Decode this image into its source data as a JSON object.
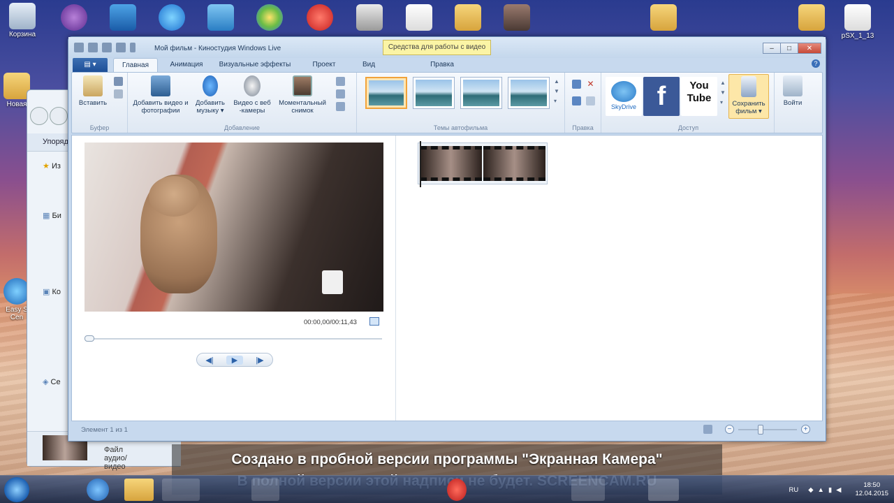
{
  "desktop": {
    "icons_left": [
      "Корзина",
      "Новая",
      "Easy S Cen"
    ],
    "icons_right": [
      "pSX_1_13"
    ]
  },
  "explorer": {
    "organize": "Упоряд",
    "tree": [
      "Из",
      "Би",
      "Ко",
      "Се"
    ],
    "status": "Файл аудио/видео"
  },
  "window": {
    "title": "Мой фильм - Киностудия Windows Live",
    "context_tab": "Средства для работы с видео",
    "context_sub": "Правка",
    "controls": {
      "min": "–",
      "max": "□",
      "close": "✕"
    }
  },
  "tabs": [
    {
      "label": ""
    },
    {
      "label": "Главная"
    },
    {
      "label": "Анимация"
    },
    {
      "label": "Визуальные эффекты"
    },
    {
      "label": "Проект"
    },
    {
      "label": "Вид"
    },
    {
      "label": "Правка"
    }
  ],
  "ribbon": {
    "buffer": {
      "paste": "Вставить",
      "label": "Буфер"
    },
    "add": {
      "add_video": "Добавить видео и фотографии",
      "add_music": "Добавить музыку ▾",
      "webcam": "Видео с веб -камеры",
      "snapshot": "Моментальный снимок",
      "label": "Добавление"
    },
    "themes": {
      "label": "Темы автофильма"
    },
    "edit": {
      "label": "Правка"
    },
    "share": {
      "skydrive": "SkyDrive",
      "facebook": "f",
      "youtube": "You Tube",
      "save_movie": "Сохранить фильм ▾",
      "label": "Доступ"
    },
    "signin": "Войти"
  },
  "preview": {
    "timecode": "00:00,00/00:11,43",
    "transport": {
      "prev": "◀|",
      "play": "▶",
      "next": "|▶"
    }
  },
  "status": {
    "text": "Элемент 1 из 1",
    "zoom_out": "−",
    "zoom_in": "+"
  },
  "watermark": {
    "line1": "Создано в пробной версии программы \"Экранная Камера\"",
    "line2": "В полной версии этой надписи не будет. SCREENCAM.RU"
  },
  "tray": {
    "lang": "RU",
    "time": "18:50",
    "date": "12.04.2015"
  },
  "colors": {
    "accent": "#1d4f97",
    "selection": "#f2a33a",
    "facebook": "#3b5998",
    "youtube": "#c4302b"
  }
}
